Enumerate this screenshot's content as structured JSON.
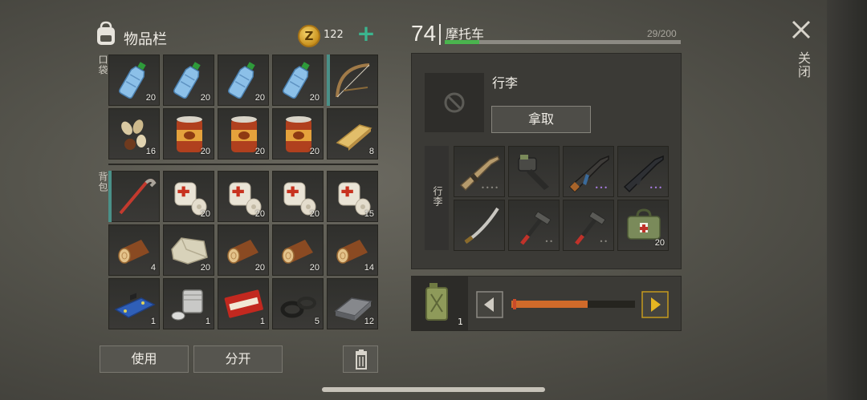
{
  "inventory": {
    "title": "物品栏",
    "coins": "122",
    "coin_symbol": "Z",
    "pocket_label": "口袋",
    "backpack_label": "背包"
  },
  "pocket_items": [
    {
      "name": "water-bottle-icon",
      "qty": "20",
      "equipped": false
    },
    {
      "name": "water-bottle-icon",
      "qty": "20",
      "equipped": false
    },
    {
      "name": "water-bottle-icon",
      "qty": "20",
      "equipped": false
    },
    {
      "name": "water-bottle-icon",
      "qty": "20",
      "equipped": false
    },
    {
      "name": "bow-icon",
      "qty": "",
      "equipped": true
    },
    {
      "name": "seeds-icon",
      "qty": "16",
      "equipped": false
    },
    {
      "name": "canned-food-icon",
      "qty": "20",
      "equipped": false
    },
    {
      "name": "canned-food-icon",
      "qty": "20",
      "equipped": false
    },
    {
      "name": "canned-food-icon",
      "qty": "20",
      "equipped": false
    },
    {
      "name": "wood-plank-icon",
      "qty": "8",
      "equipped": false
    }
  ],
  "backpack_items": [
    {
      "name": "crowbar-icon",
      "qty": "",
      "equipped": true
    },
    {
      "name": "bandage-icon",
      "qty": "20",
      "equipped": false
    },
    {
      "name": "bandage-icon",
      "qty": "20",
      "equipped": false
    },
    {
      "name": "bandage-icon",
      "qty": "20",
      "equipped": false
    },
    {
      "name": "bandage-icon",
      "qty": "15",
      "equipped": false
    },
    {
      "name": "log-icon",
      "qty": "4",
      "equipped": false
    },
    {
      "name": "stone-icon",
      "qty": "20",
      "equipped": false
    },
    {
      "name": "log-icon",
      "qty": "20",
      "equipped": false
    },
    {
      "name": "log-icon",
      "qty": "20",
      "equipped": false
    },
    {
      "name": "log-icon",
      "qty": "14",
      "equipped": false
    },
    {
      "name": "circuit-board-icon",
      "qty": "1",
      "equipped": false
    },
    {
      "name": "engine-part-icon",
      "qty": "1",
      "equipped": false
    },
    {
      "name": "coupon-icon",
      "qty": "1",
      "equipped": false
    },
    {
      "name": "rubber-rings-icon",
      "qty": "5",
      "equipped": false
    },
    {
      "name": "metal-ingot-icon",
      "qty": "12",
      "equipped": false
    }
  ],
  "actions": {
    "use_label": "使用",
    "split_label": "分开"
  },
  "vehicle": {
    "level": "74",
    "name": "摩托车",
    "capacity_text": "29/200",
    "capacity_fraction": 0.145,
    "luggage_title": "行李",
    "take_label": "拿取",
    "luggage_side_label": "行李"
  },
  "vehicle_items": [
    {
      "name": "scar-rifle-icon",
      "qty": "",
      "dots": "••••",
      "dot_color": "#8a8780"
    },
    {
      "name": "chainsaw-icon",
      "qty": "",
      "dots": "",
      "dot_color": "#8a8780"
    },
    {
      "name": "ak-rifle-icon",
      "qty": "",
      "dots": "•••",
      "dot_color": "#a77be0"
    },
    {
      "name": "m4-rifle-icon",
      "qty": "",
      "dots": "•••",
      "dot_color": "#a77be0"
    },
    {
      "name": "katana-icon",
      "qty": "",
      "dots": "",
      "dot_color": "#8a8780"
    },
    {
      "name": "hammer-icon",
      "qty": "",
      "dots": "••",
      "dot_color": "#8a8780"
    },
    {
      "name": "hammer-icon",
      "qty": "",
      "dots": "••",
      "dot_color": "#8a8780"
    },
    {
      "name": "medkit-bag-icon",
      "qty": "20",
      "dots": "",
      "dot_color": "#8a8780"
    }
  ],
  "fuel": {
    "qty": "1",
    "level_fraction": 0.62,
    "bar_color": "#d06a2a"
  },
  "close_label": "关闭"
}
